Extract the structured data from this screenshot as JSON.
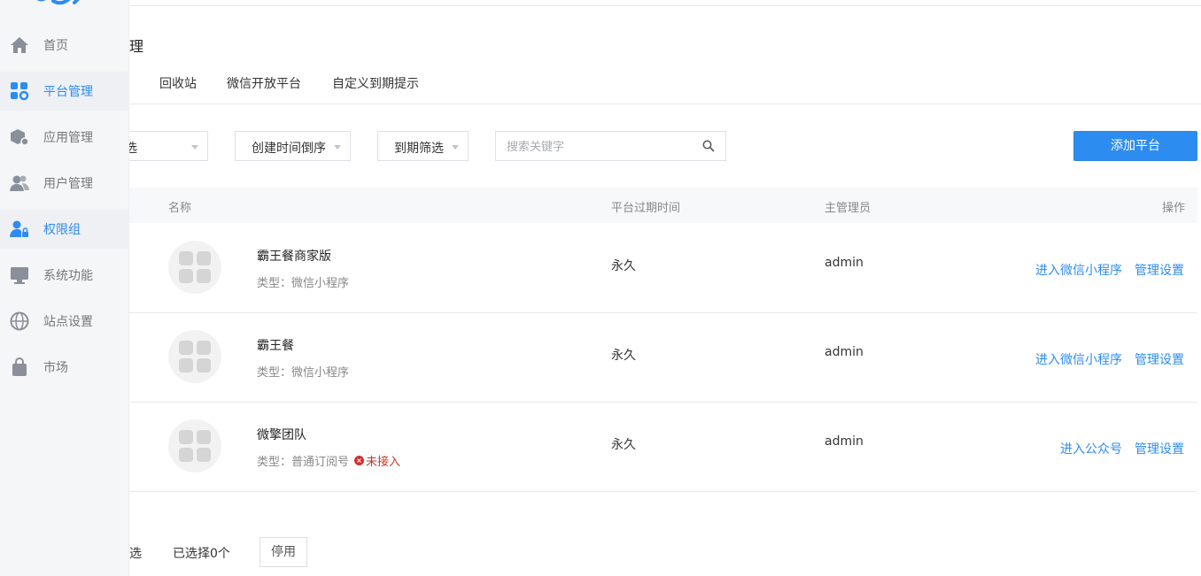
{
  "sidebar": {
    "logo_fragment": "",
    "items": [
      {
        "label": "首页",
        "icon": "home-icon"
      },
      {
        "label": "平台管理",
        "icon": "grid-gear-icon",
        "active": true
      },
      {
        "label": "应用管理",
        "icon": "cube-icon"
      },
      {
        "label": "用户管理",
        "icon": "users-icon"
      },
      {
        "label": "权限组",
        "icon": "user-lock-icon",
        "active": true
      },
      {
        "label": "系统功能",
        "icon": "monitor-icon"
      },
      {
        "label": "站点设置",
        "icon": "globe-icon"
      },
      {
        "label": "市场",
        "icon": "bag-icon"
      }
    ]
  },
  "page": {
    "title_fragment": "理"
  },
  "tabs": [
    "回收站",
    "微信开放平台",
    "自定义到期提示"
  ],
  "filters": {
    "type": "类型筛选",
    "sort": "创建时间倒序",
    "expire": "到期筛选",
    "search_placeholder": "搜索关键字",
    "add_button": "添加平台"
  },
  "table": {
    "headers": {
      "name": "名称",
      "expire": "平台过期时间",
      "admin": "主管理员",
      "ops": "操作"
    },
    "rows": [
      {
        "name": "霸王餐商家版",
        "type": "类型：微信小程序",
        "warning": "",
        "expire": "永久",
        "admin": "admin",
        "op1": "进入微信小程序",
        "op2": "管理设置"
      },
      {
        "name": "霸王餐",
        "type": "类型：微信小程序",
        "warning": "",
        "expire": "永久",
        "admin": "admin",
        "op1": "进入微信小程序",
        "op2": "管理设置"
      },
      {
        "name": "微擎团队",
        "type": "类型：普通订阅号",
        "warning": "未接入",
        "expire": "永久",
        "admin": "admin",
        "op1": "进入公众号",
        "op2": "管理设置"
      }
    ]
  },
  "footer": {
    "select_all_fragment": "选",
    "selected_count": "已选择0个",
    "disable_button": "停用"
  },
  "colors": {
    "accent": "#2d8cf0",
    "warning": "#d0312d"
  }
}
